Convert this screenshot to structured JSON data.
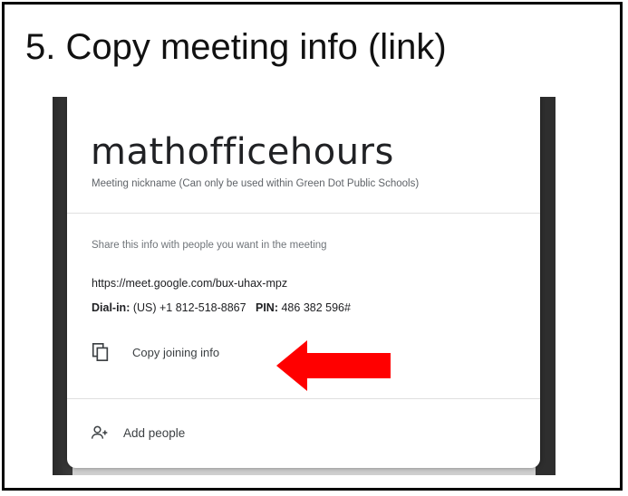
{
  "slide": {
    "title": "5. Copy meeting info (link)"
  },
  "meeting": {
    "name": "mathofficehours",
    "nickname_note": "Meeting nickname (Can only be used within Green Dot Public Schools)",
    "share_note": "Share this info with people you want in the meeting",
    "link": "https://meet.google.com/bux-uhax-mpz",
    "dial_label": "Dial-in:",
    "dial_number": "(US) +1 812-518-8867",
    "pin_label": "PIN:",
    "pin": "486 382 596#"
  },
  "actions": {
    "copy_label": "Copy joining info",
    "add_people_label": "Add people"
  },
  "icons": {
    "copy": "copy-icon",
    "add_people": "add-person-icon",
    "arrow": "red-arrow-icon"
  },
  "colors": {
    "arrow": "#ff0000",
    "text": "#202124"
  }
}
